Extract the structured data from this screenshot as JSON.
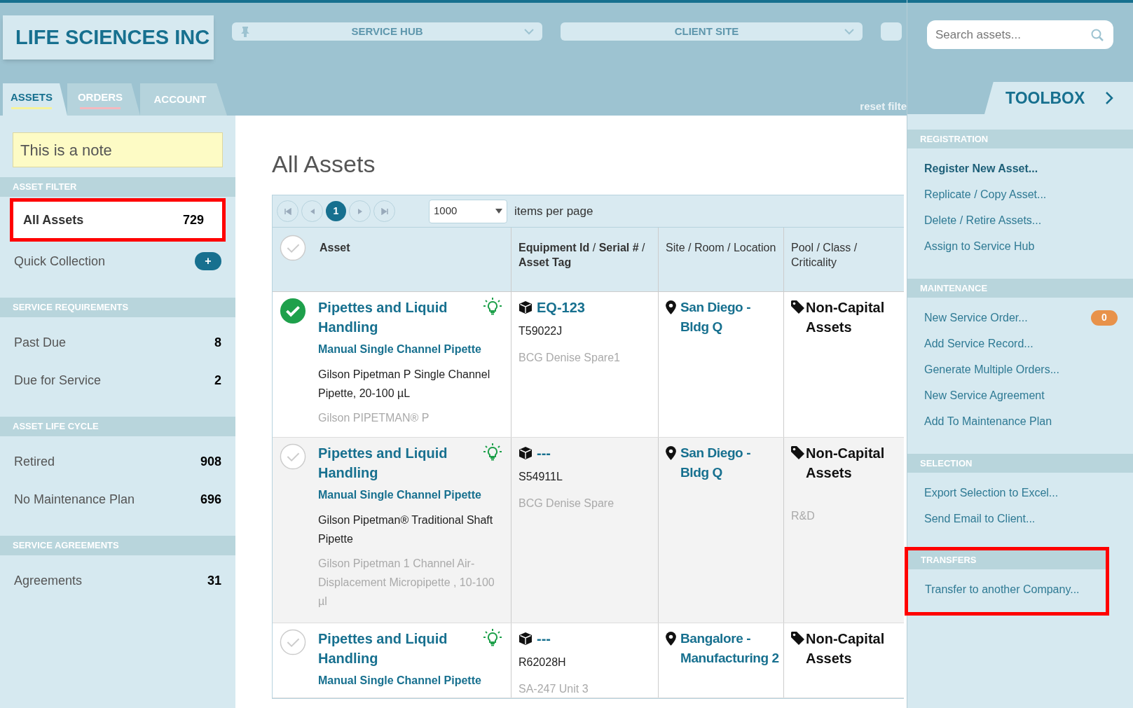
{
  "header": {
    "logo": "LIFE SCIENCES INC",
    "dropdowns": [
      {
        "label": "SERVICE HUB",
        "pinned": true
      },
      {
        "label": "CLIENT SITE",
        "pinned": false
      },
      {
        "pinned": false
      }
    ],
    "tabs": [
      {
        "label": "ASSETS",
        "selected": true,
        "color": "#f6f29a"
      },
      {
        "label": "ORDERS",
        "selected": false,
        "color": "#f4b9bf"
      },
      {
        "label": "ACCOUNT",
        "selected": false
      }
    ],
    "reset_link": "reset filte"
  },
  "sidebar": {
    "note": "This is a note",
    "sections": [
      {
        "title": "ASSET FILTER",
        "items": [
          {
            "kind": "count",
            "label": "All Assets",
            "count": "729",
            "selected": true,
            "highlighted": true
          },
          {
            "kind": "add",
            "label": "Quick Collection",
            "button": "+",
            "selected": false,
            "highlighted": false
          }
        ]
      },
      {
        "title": "SERVICE REQUIREMENTS",
        "items": [
          {
            "kind": "count",
            "label": "Past Due",
            "count": "8",
            "selected": false,
            "highlighted": false
          },
          {
            "kind": "count",
            "label": "Due for Service",
            "count": "2",
            "selected": false,
            "highlighted": false
          }
        ]
      },
      {
        "title": "ASSET LIFE CYCLE",
        "items": [
          {
            "kind": "count",
            "label": "Retired",
            "count": "908",
            "selected": false,
            "highlighted": false
          },
          {
            "kind": "count",
            "label": "No Maintenance Plan",
            "count": "696",
            "selected": false,
            "highlighted": false
          }
        ]
      },
      {
        "title": "SERVICE AGREEMENTS",
        "items": [
          {
            "kind": "count",
            "label": "Agreements",
            "count": "31",
            "selected": false,
            "highlighted": false
          }
        ]
      }
    ]
  },
  "main": {
    "title": "All Assets",
    "pager": {
      "pages": [
        {
          "label": "1",
          "selected": true
        }
      ],
      "per_page": "1000",
      "per_page_label": "items per page"
    },
    "table": {
      "select_all_checked": false,
      "columns": [
        {
          "label": "Asset",
          "bold": true
        },
        {
          "label": "**Equipment Id** / **Serial #** / **Asset Tag**",
          "bold": false
        },
        {
          "label": "Site / Room / Location",
          "bold": false
        },
        {
          "label": "Pool / Class / Criticality",
          "bold": false
        }
      ],
      "rows": [
        {
          "checked": true,
          "asset_type": "Pipettes and Liquid Handling",
          "model": "Manual Single Channel Pipette",
          "description": "Gilson Pipetman P Single Channel Pipette, 20-100 µL",
          "manufacturer_model": "Gilson PIPETMAN® P",
          "equipment_id": "EQ-123",
          "serial": "T59022J",
          "asset_tag": "BCG Denise Spare1",
          "site": "San Diego - Bldg Q",
          "pool": "Non-Capital Assets"
        },
        {
          "checked": false,
          "asset_type": "Pipettes and Liquid Handling",
          "model": "Manual Single Channel Pipette",
          "description": "Gilson Pipetman® Traditional Shaft Pipette",
          "manufacturer_model": "Gilson Pipetman 1 Channel Air-Displacement Micropipette , 10-100 µl",
          "equipment_id": "---",
          "serial": "S54911L",
          "asset_tag": "BCG Denise Spare",
          "site": "San Diego - Bldg Q",
          "pool": "Non-Capital Assets",
          "class": "R&D"
        },
        {
          "checked": false,
          "asset_type": "Pipettes and Liquid Handling",
          "model": "Manual Single Channel Pipette",
          "equipment_id": "---",
          "serial": "R62028H",
          "asset_tag": "SA-247 Unit 3",
          "site": "Bangalore - Manufacturing 2",
          "pool": "Non-Capital Assets"
        }
      ]
    }
  },
  "toolbox": {
    "search_placeholder": "Search assets...",
    "title": "TOOLBOX",
    "sections": [
      {
        "title": "REGISTRATION",
        "highlighted": false,
        "items": [
          {
            "kind": "primary",
            "label": "Register New Asset..."
          },
          {
            "kind": "link",
            "label": "Replicate / Copy Asset..."
          },
          {
            "kind": "link",
            "label": "Delete / Retire Assets..."
          },
          {
            "kind": "link",
            "label": "Assign to Service Hub"
          }
        ]
      },
      {
        "title": "MAINTENANCE",
        "highlighted": false,
        "items": [
          {
            "kind": "link",
            "label": "New Service Order...",
            "badge": "0"
          },
          {
            "kind": "link",
            "label": "Add Service Record..."
          },
          {
            "kind": "link",
            "label": "Generate Multiple Orders..."
          },
          {
            "kind": "link",
            "label": "New Service Agreement"
          },
          {
            "kind": "link",
            "label": "Add To Maintenance Plan"
          }
        ]
      },
      {
        "title": "SELECTION",
        "highlighted": false,
        "items": [
          {
            "kind": "link",
            "label": "Export Selection to Excel..."
          },
          {
            "kind": "link",
            "label": "Send Email to Client..."
          }
        ]
      },
      {
        "title": "TRANSFERS",
        "highlighted": true,
        "items": [
          {
            "kind": "link",
            "label": "Transfer to another Company..."
          }
        ]
      }
    ]
  }
}
